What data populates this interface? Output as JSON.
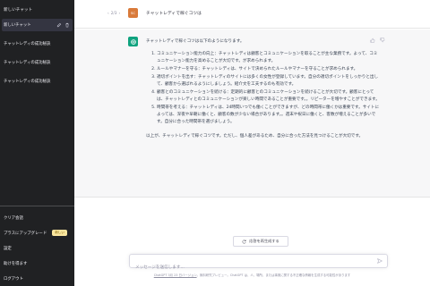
{
  "sidebar": {
    "new_chat": "新しいチャット",
    "conversations": [
      {
        "label": "新しいチャット",
        "active": true
      },
      {
        "label": "チャットレディの成功秘訣",
        "active": false
      },
      {
        "label": "チャットレディの成功秘訣",
        "active": false
      },
      {
        "label": "チャットレディの成功秘訣",
        "active": false
      }
    ],
    "bottom": {
      "clear": "クリア会話",
      "upgrade": "プラスにアップグレード",
      "badge": "新しい",
      "settings": "設定",
      "help": "助けを得ます",
      "logout": "ログアウト"
    }
  },
  "chat": {
    "pager": {
      "prev": "‹",
      "current": "2/3",
      "next": "›"
    },
    "user_avatar": "SC",
    "user_message": "チャットレディで稼ぐコツは",
    "bot_intro": "チャットレディで稼ぐコツは以下のようになります。",
    "bot_items": [
      "コミュニケーション能力の向上：チャットレディは顧客とコミュニケーションを取ることが主な業務です。よって、コミュニケーション能力を高めることが大切です。が求められます。",
      "ルールやマナーを守る：チャットレディは、サイトで決められたルールやマナーを守ることが求められます。",
      "適切ポイントを出す：チャットレディのサイトには多くの女性が登録しています。自分の適切ポイントをしっかりと出して、顧客から選ばれるようにしましょう。紹介文を工夫するのも有効です。",
      "顧客とのコミュニケーションを続ける：定期的に顧客とのコミュニケーションを続けることが大切です。顧客にとっては、チャットレディとのコミュニケーションが楽しい時間であることが重要です。。リピーターを増やすことができます。",
      "時間帯を考える：チャットレディは、24時間いつでも働くことができますが、どの時間帯に働くかは重要です。サイトによっては、深夜や早朝に働くと、顧客の数が少ない場合があります。。週末や祝日に働くと、客数が増えることが多いです。自分に合った時間帯を選びましょう。"
    ],
    "bot_outro": "以上が、チャットレディで稼ぐコツです。ただし、個人差があるため、自分に合った方法を見つけることが大切です。",
    "regenerate": "応答を再生成する",
    "input_placeholder": "メッセージを送信します...",
    "footer_link": "ChatGPT 3月 23 日バージョン",
    "footer_text": "。無料研究プレビュー。ChatGPT は、人、場所、または事実に関する不正確な情報を生成する可能性があります"
  },
  "colors": {
    "sidebar_bg": "#202123",
    "accent_green": "#10a37f",
    "user_avatar": "#d97a3a"
  }
}
